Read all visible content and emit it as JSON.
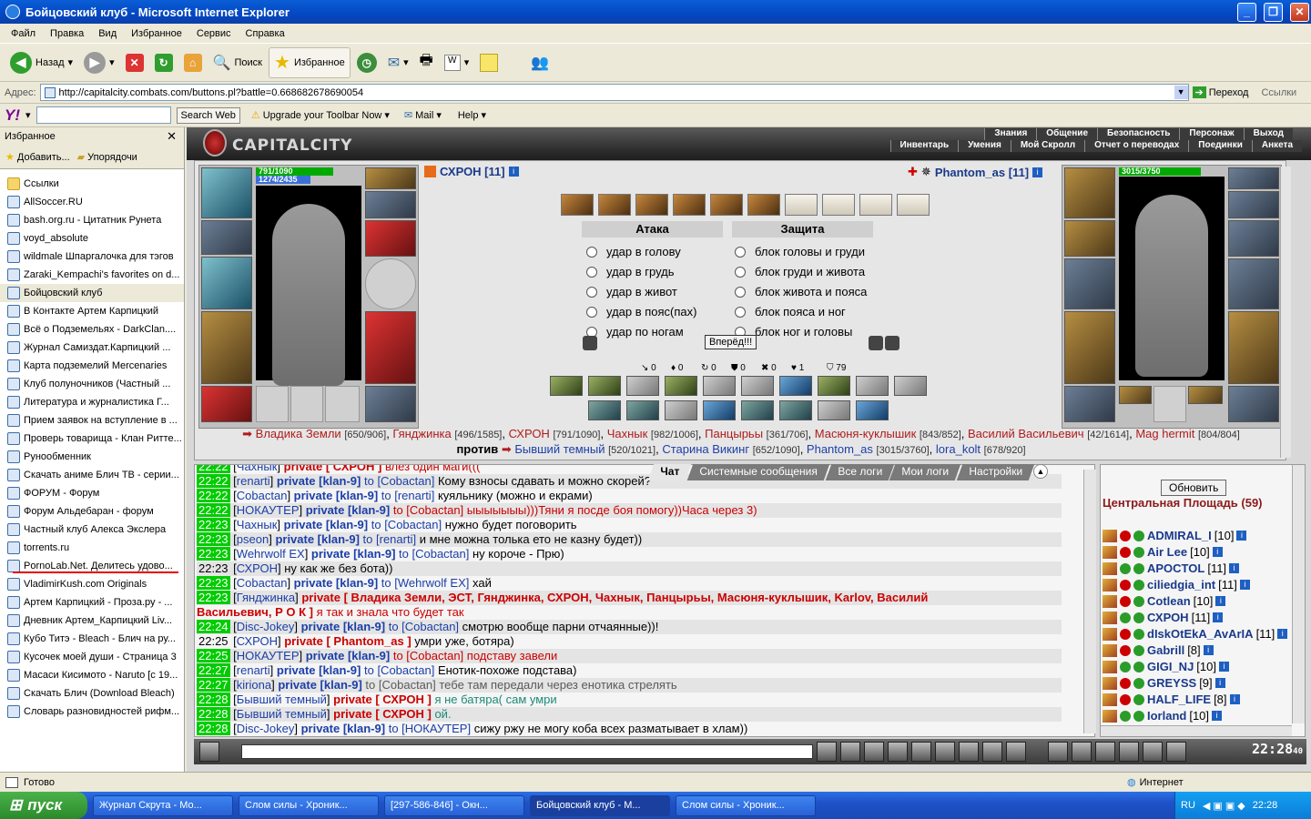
{
  "window": {
    "title": "Бойцовский клуб - Microsoft Internet Explorer"
  },
  "menu": [
    "Файл",
    "Правка",
    "Вид",
    "Избранное",
    "Сервис",
    "Справка"
  ],
  "toolbar": {
    "back": "Назад",
    "search": "Поиск",
    "favorites": "Избранное"
  },
  "address": {
    "label": "Адрес:",
    "url": "http://capitalcity.combats.com/buttons.pl?battle=0.668682678690054",
    "go": "Переход",
    "links": "Ссылки"
  },
  "yahoo": {
    "search_btn": "Search Web",
    "upgrade": "Upgrade your Toolbar Now",
    "mail": "Mail",
    "help": "Help"
  },
  "favorites": {
    "title": "Избранное",
    "add": "Добавить...",
    "organize": "Упорядочи",
    "items": [
      "Ссылки",
      "AllSoccer.RU",
      "bash.org.ru - Цитатник Рунета",
      "voyd_absolute",
      "wildmale Шпаргалочка для тэгов",
      "Zaraki_Kempachi's favorites on d...",
      "Бойцовский клуб",
      "В Контакте  Артем Карпицкий",
      "Всё о Подземельях - DarkClan....",
      "Журнал Самиздат.Карпицкий ...",
      "Карта подземелий  Mercenaries",
      "Клуб полуночников (Частный ...",
      "Литература и журналистика  Г...",
      "Прием заявок на вступление в ...",
      "Проверь товарища - Клан Ритте...",
      "Рунообменник",
      "Скачать аниме Блич ТВ - серии...",
      "ФОРУМ - Форум",
      "Форум Альдебаран - форум",
      "Частный клуб Алекса Экслера",
      "torrents.ru",
      "PornoLab.Net. Делитесь удово...",
      "VladimirKush.com Originals",
      "Артем Карпицкий - Проза.ру - ...",
      "Дневник Артем_Карпицкий  Liv...",
      "Кубо Титэ - Bleach - Блич на ру...",
      "Кусочек моей души - Страница 3",
      "Масаси Кисимото - Naruto [c 19...",
      "Скачать Блич (Download Bleach)",
      "Словарь разновидностей рифм..."
    ]
  },
  "game": {
    "logo": "CAPITALCITY",
    "nav1": [
      "Знания",
      "Общение",
      "Безопасность",
      "Персонаж",
      "Выход"
    ],
    "nav2": [
      "Инвентарь",
      "Умения",
      "Мой Скролл",
      "Отчет о переводах",
      "Поединки",
      "Анкета"
    ],
    "left_player": {
      "name": "СХРОН [11]",
      "hp": "791/1090",
      "mp": "1274/2435",
      "hp_frac": 0.73,
      "mp_frac": 0.52
    },
    "right_player": {
      "name": "Phantom_as [11]",
      "hp": "3015/3750",
      "hp_frac": 0.8
    },
    "attack_title": "Атака",
    "defense_title": "Защита",
    "attack": [
      "удар в голову",
      "удар в грудь",
      "удар в живот",
      "удар в пояс(пах)",
      "удар по ногам"
    ],
    "defense": [
      "блок головы и груди",
      "блок груди и живота",
      "блок живота и пояса",
      "блок пояса и ног",
      "блок ног и головы"
    ],
    "go_button": "Вперёд!!!",
    "stats": [
      "0",
      "0",
      "0",
      "0",
      "0",
      "1",
      "79"
    ],
    "vs": "против"
  },
  "teams": {
    "team1": [
      {
        "name": "Владика Земли",
        "hp": "[650/906]"
      },
      {
        "name": "Гянджинка",
        "hp": "[496/1585]"
      },
      {
        "name": "СХРОН",
        "hp": "[791/1090]"
      },
      {
        "name": "Чахнык",
        "hp": "[982/1006]"
      },
      {
        "name": "Панцырьы",
        "hp": "[361/706]"
      },
      {
        "name": "Масюня-куклышик",
        "hp": "[843/852]"
      },
      {
        "name": "Василий Васильевич",
        "hp": "[42/1614]"
      },
      {
        "name": "Mag hermit",
        "hp": "[804/804]"
      }
    ],
    "team2": [
      {
        "name": "Бывший темный",
        "hp": "[520/1021]"
      },
      {
        "name": "Старина Викинг",
        "hp": "[652/1090]"
      },
      {
        "name": "Phantom_as",
        "hp": "[3015/3760]"
      },
      {
        "name": "lora_kolt",
        "hp": "[678/920]"
      }
    ]
  },
  "chat_tabs": [
    "Чат",
    "Системные сообщения",
    "Все логи",
    "Мои логи",
    "Настройки"
  ],
  "chat": [
    {
      "t": "22:22",
      "who": "Чахнык",
      "p": "private [ СХРОН ]",
      "red": true,
      "msg": "влез один маги(((",
      "mc": "r"
    },
    {
      "t": "22:22",
      "who": "renarti",
      "p": "private [klan-9]",
      "to": "to [Cobactan]",
      "msg": "Кому взносы сдавать и можно скорей?"
    },
    {
      "t": "22:22",
      "who": "Cobactan",
      "p": "private [klan-9]",
      "to": "to [renarti]",
      "msg": "куяльнику (можно и екрами)"
    },
    {
      "t": "22:22",
      "who": "НОКАУТЕР",
      "p": "private [klan-9]",
      "to": "to [Cobactan]",
      "msg": "ыыыыыыы)))Тяни я посде боя помогу))Часа через 3)",
      "mc": "r",
      "tored": true
    },
    {
      "t": "22:23",
      "who": "Чахнык",
      "p": "private [klan-9]",
      "to": "to [Cobactan]",
      "msg": "нужно будет поговорить"
    },
    {
      "t": "22:23",
      "who": "pseon",
      "p": "private [klan-9]",
      "to": "to [renarti]",
      "msg": "и мне можна толька ето не казну будет))"
    },
    {
      "t": "22:23",
      "who": "Wehrwolf EX",
      "p": "private [klan-9]",
      "to": "to [Cobactan]",
      "msg": "ну короче - Прю)"
    },
    {
      "t": "22:23",
      "who": "СХРОН",
      "plain": true,
      "msg": "ну как же без бота))"
    },
    {
      "t": "22:23",
      "who": "Cobactan",
      "p": "private [klan-9]",
      "to": "to [Wehrwolf EX]",
      "msg": "хай"
    },
    {
      "t": "22:23",
      "who": "Гянджинка",
      "p": "private [ Владика Земли, ЭСТ, Гянджинка, СХРОН, Чахнык, Панцырьы, Масюня-куклышик, Karlov, Василий",
      "red": true
    },
    {
      "cont": "Васильевич, Р О К ]",
      "msg": "я так и знала что будет так",
      "mc": "r"
    },
    {
      "t": "22:24",
      "who": "Disc-Jokey",
      "p": "private [klan-9]",
      "to": "to [Cobactan]",
      "msg": "смотрю вообще парни отчаянные))!"
    },
    {
      "t": "22:25",
      "who": "СХРОН",
      "plainT": true,
      "p": "private [ Phantom_as ]",
      "red": true,
      "msg": "умри уже, ботяра)"
    },
    {
      "t": "22:25",
      "who": "НОКАУТЕР",
      "p": "private [klan-9]",
      "to": "to [Cobactan]",
      "msg": "подставу завели",
      "mc": "r",
      "tored": true
    },
    {
      "t": "22:27",
      "who": "renarti",
      "p": "private [klan-9]",
      "to": "to [Cobactan]",
      "msg": "Енотик-похоже подстава)"
    },
    {
      "t": "22:27",
      "who": "kiriona",
      "p": "private [klan-9]",
      "to": "to [Cobactan]",
      "msg": "тебе там передали через енотика стрелять",
      "mc": "g",
      "togr": true
    },
    {
      "t": "22:28",
      "who": "Бывший темный",
      "p": "private [ СХРОН ]",
      "red": true,
      "msg": "я не батяра( сам умри",
      "mc": "t"
    },
    {
      "t": "22:28",
      "who": "Бывший темный",
      "p": "private [ СХРОН ]",
      "red": true,
      "msg": "ой.",
      "mc": "t"
    },
    {
      "t": "22:28",
      "who": "Disc-Jokey",
      "p": "private [klan-9]",
      "to": "to [НОКАУТЕР]",
      "msg": "сижу ржу не могу коба всех разматывает в хлам))"
    }
  ],
  "users": {
    "refresh": "Обновить",
    "location": "Центральная Площадь (59)",
    "list": [
      {
        "n": "ADMIRAL_I",
        "l": "[10]"
      },
      {
        "n": "Air Lee",
        "l": "[10]"
      },
      {
        "n": "APOCTOL",
        "l": "[11]"
      },
      {
        "n": "ciliedgia_int",
        "l": "[11]"
      },
      {
        "n": "Cotlean",
        "l": "[10]"
      },
      {
        "n": "СХРОН",
        "l": "[11]"
      },
      {
        "n": "dIskOtEkA_AvArIA",
        "l": "[11]"
      },
      {
        "n": "Gabrill",
        "l": "[8]"
      },
      {
        "n": "GIGI_NJ",
        "l": "[10]"
      },
      {
        "n": "GREYSS",
        "l": "[9]"
      },
      {
        "n": "HALF_LIFE",
        "l": "[8]"
      },
      {
        "n": "Iorland",
        "l": "[10]"
      }
    ]
  },
  "clock": "22:28",
  "clock_sec": "40",
  "status": {
    "text": "Готово",
    "zone": "Интернет"
  },
  "taskbar": {
    "start": "пуск",
    "tasks": [
      "Журнал Скрута - Мо...",
      "Слом силы - Хроник...",
      "[297-586-846] - Окн...",
      "Бойцовский клуб - М...",
      "Слом силы - Хроник..."
    ],
    "lang": "RU",
    "time": "22:28"
  }
}
